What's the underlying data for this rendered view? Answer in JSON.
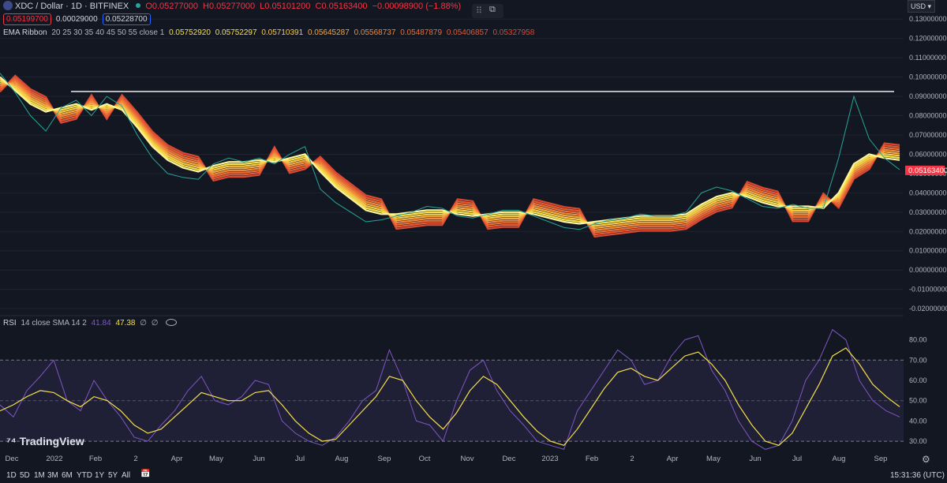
{
  "header": {
    "symbol": "XDC / Dollar · 1D · BITFINEX",
    "ohlc": {
      "o": "O0.05277000",
      "h": "H0.05277000",
      "l": "L0.05101200",
      "c": "C0.05163400",
      "chg": "−0.00098900 (−1.88%)"
    },
    "bid": "0.05199700",
    "spread": "0.00029000",
    "ask": "0.05228700",
    "currency": "USD"
  },
  "ema_legend": {
    "label": "EMA Ribbon",
    "params": "20 25 30 35 40 45 50 55 close 1",
    "values": [
      "0.05752920",
      "0.05752297",
      "0.05710391",
      "0.05645287",
      "0.05568737",
      "0.05487879",
      "0.05406857",
      "0.05327958"
    ]
  },
  "rsi_legend": {
    "label": "RSI",
    "params": "14 close SMA 14 2",
    "rsi": "41.84",
    "sma": "47.38",
    "extra1": "∅",
    "extra2": "∅"
  },
  "colors": {
    "rsi": "#7e57c2",
    "rsi_ma": "#f5e04a",
    "line": "#ffffff",
    "current_price": "#f23645",
    "ema_light": "#fff59d",
    "ema_dark": "#e53935"
  },
  "timeframes": [
    "1D",
    "5D",
    "1M",
    "3M",
    "6M",
    "YTD",
    "1Y",
    "5Y",
    "All"
  ],
  "clock": "15:31:36 (UTC)",
  "brand": "TradingView",
  "chart_data": [
    {
      "type": "line",
      "title": "XDC / Dollar · 1D · BITFINEX",
      "x_ticks": [
        "Dec",
        "2022",
        "Feb",
        "2",
        "Apr",
        "May",
        "Jun",
        "Jul",
        "Aug",
        "Sep",
        "Oct",
        "Nov",
        "Dec",
        "2023",
        "Feb",
        "2",
        "Apr",
        "May",
        "Jun",
        "Jul",
        "Aug",
        "Sep"
      ],
      "y_ticks": [
        "0.13000000",
        "0.12000000",
        "0.11000000",
        "0.10000000",
        "0.09000000",
        "0.08000000",
        "0.07000000",
        "0.06000000",
        "0.05000000",
        "0.04000000",
        "0.03000000",
        "0.02000000",
        "0.01000000",
        "0.00000000",
        "-0.01000000",
        "-0.02000000"
      ],
      "ylim": [
        -0.022,
        0.135
      ],
      "current_price": 0.051634,
      "current_price_label": "0.05163400",
      "horizontal_line": 0.0925,
      "series": [
        {
          "values": [
            0.102,
            0.092,
            0.08,
            0.072,
            0.084,
            0.088,
            0.08,
            0.09,
            0.085,
            0.07,
            0.058,
            0.05,
            0.048,
            0.047,
            0.055,
            0.058,
            0.056,
            0.058,
            0.055,
            0.06,
            0.064,
            0.042,
            0.035,
            0.03,
            0.025,
            0.026,
            0.028,
            0.03,
            0.033,
            0.032,
            0.028,
            0.027,
            0.029,
            0.031,
            0.031,
            0.028,
            0.025,
            0.022,
            0.021,
            0.024,
            0.026,
            0.027,
            0.029,
            0.028,
            0.028,
            0.03,
            0.04,
            0.043,
            0.041,
            0.037,
            0.033,
            0.032,
            0.034,
            0.032,
            0.032,
            0.058,
            0.09,
            0.068,
            0.058,
            0.052
          ]
        },
        {
          "name": "EMA Ribbon",
          "values": [
            0.1,
            0.093,
            0.086,
            0.082,
            0.084,
            0.086,
            0.083,
            0.086,
            0.083,
            0.074,
            0.064,
            0.057,
            0.053,
            0.051,
            0.054,
            0.056,
            0.056,
            0.057,
            0.056,
            0.058,
            0.06,
            0.051,
            0.043,
            0.037,
            0.031,
            0.029,
            0.029,
            0.03,
            0.031,
            0.031,
            0.029,
            0.028,
            0.029,
            0.03,
            0.03,
            0.029,
            0.027,
            0.025,
            0.024,
            0.025,
            0.026,
            0.027,
            0.028,
            0.028,
            0.028,
            0.029,
            0.034,
            0.038,
            0.04,
            0.038,
            0.035,
            0.033,
            0.033,
            0.033,
            0.032,
            0.04,
            0.055,
            0.06,
            0.058,
            0.057
          ]
        }
      ]
    },
    {
      "type": "line",
      "title": "RSI 14 close SMA 14 2",
      "y_ticks": [
        "80.00",
        "70.00",
        "60.00",
        "50.00",
        "40.00",
        "30.00"
      ],
      "ylim": [
        25,
        88
      ],
      "band": [
        30,
        70
      ],
      "series": [
        {
          "name": "RSI",
          "values": [
            48,
            42,
            55,
            62,
            70,
            50,
            45,
            60,
            50,
            42,
            32,
            30,
            38,
            45,
            55,
            62,
            50,
            48,
            52,
            60,
            58,
            40,
            34,
            30,
            28,
            32,
            40,
            50,
            55,
            75,
            60,
            40,
            38,
            30,
            50,
            65,
            70,
            55,
            45,
            38,
            30,
            28,
            26,
            45,
            55,
            65,
            75,
            70,
            58,
            60,
            72,
            80,
            82,
            65,
            55,
            40,
            30,
            26,
            28,
            40,
            60,
            70,
            85,
            80,
            60,
            50,
            45,
            42
          ]
        },
        {
          "name": "SMA",
          "values": [
            45,
            48,
            52,
            55,
            54,
            50,
            47,
            52,
            50,
            45,
            38,
            34,
            36,
            42,
            48,
            54,
            52,
            50,
            50,
            54,
            55,
            48,
            40,
            34,
            30,
            31,
            38,
            45,
            52,
            62,
            60,
            50,
            42,
            36,
            44,
            55,
            62,
            58,
            50,
            42,
            35,
            30,
            28,
            36,
            46,
            56,
            64,
            66,
            62,
            60,
            66,
            72,
            74,
            68,
            60,
            48,
            38,
            30,
            28,
            34,
            46,
            58,
            72,
            76,
            68,
            58,
            52,
            47
          ]
        }
      ]
    }
  ]
}
